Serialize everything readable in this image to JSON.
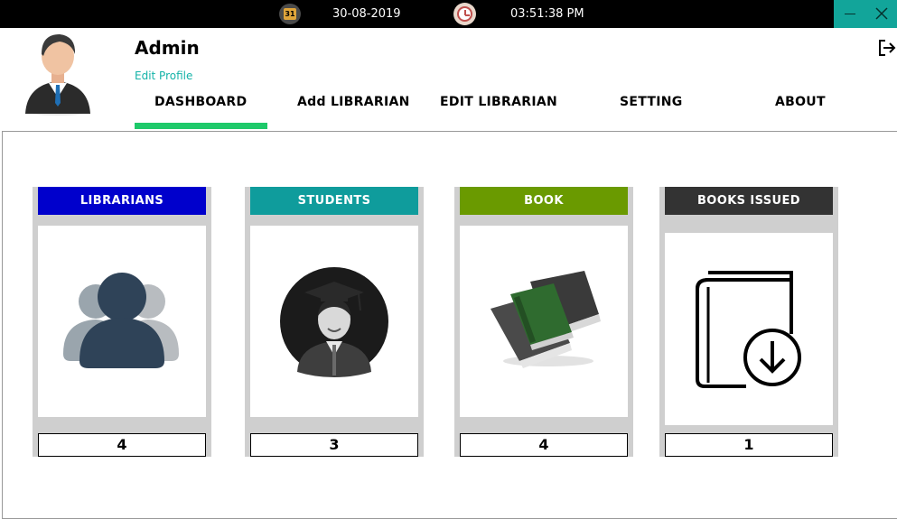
{
  "statusbar": {
    "date": "30-08-2019",
    "time": "03:51:38 PM",
    "calendar_day": "31"
  },
  "window": {
    "minimize_icon": "minimize-icon",
    "close_icon": "close-icon",
    "accent": "#12a59a"
  },
  "header": {
    "user_name": "Admin",
    "edit_profile": "Edit Profile",
    "link_color": "#14b3a8"
  },
  "nav": {
    "items": [
      {
        "label": "DASHBOARD",
        "active": true
      },
      {
        "label": "Add LIBRARIAN"
      },
      {
        "label": "EDIT LIBRARIAN"
      },
      {
        "label": "SETTING"
      },
      {
        "label": "ABOUT"
      }
    ],
    "active_color": "#1ec96a"
  },
  "cards": [
    {
      "title": "LIBRARIANS",
      "count": "4",
      "color": "#0000cc",
      "icon": "users-group-icon"
    },
    {
      "title": "STUDENTS",
      "count": "3",
      "color": "#0f9c9c",
      "icon": "graduate-icon"
    },
    {
      "title": "BOOK",
      "count": "4",
      "color": "#6a9a00",
      "icon": "books-icon"
    },
    {
      "title": "BOOKS ISSUED",
      "count": "1",
      "color": "#333333",
      "icon": "book-download-icon"
    }
  ]
}
